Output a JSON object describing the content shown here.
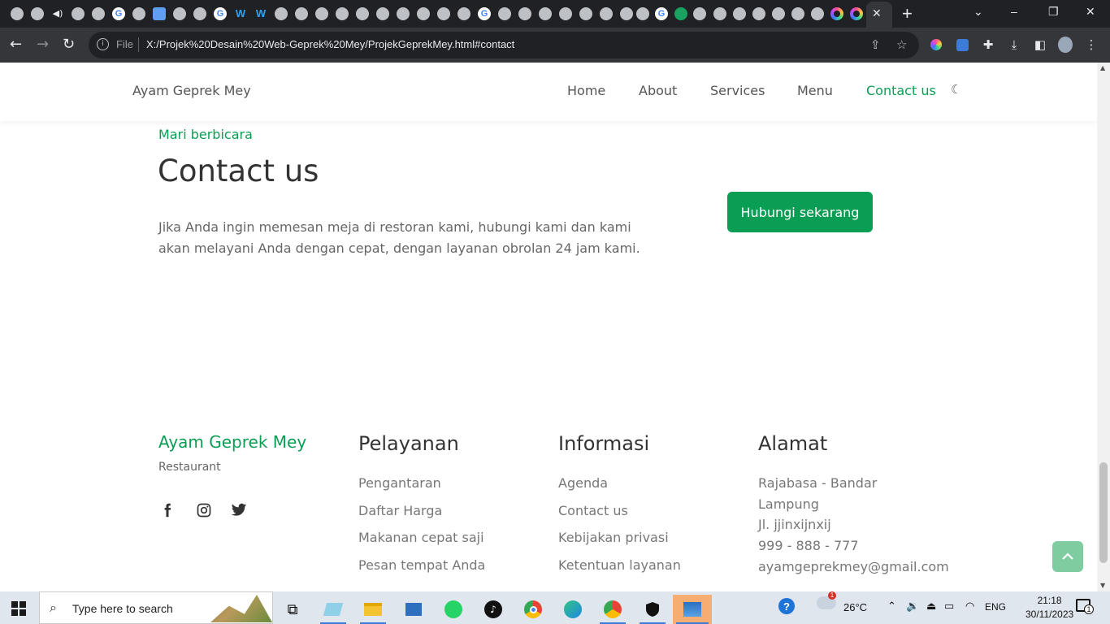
{
  "browser": {
    "tab_close": "✕",
    "new_tab": "+",
    "window_controls": {
      "dropdown": "⌄",
      "minimize": "–",
      "restore": "❐",
      "close": "✕"
    },
    "address": {
      "scheme_label": "File",
      "url": "X:/Projek%20Desain%20Web-Geprek%20Mey/ProjekGeprekMey.html#contact"
    }
  },
  "site": {
    "brand": "Ayam Geprek Mey",
    "nav": {
      "home": "Home",
      "about": "About",
      "services": "Services",
      "menu": "Menu",
      "contact": "Contact us"
    }
  },
  "contact": {
    "eyebrow": "Mari berbicara",
    "title": "Contact us",
    "text": "Jika Anda ingin memesan meja di restoran kami, hubungi kami dan kami akan melayani Anda dengan cepat, dengan layanan obrolan 24 jam kami.",
    "cta": "Hubungi sekarang"
  },
  "footer": {
    "brand": "Ayam Geprek Mey",
    "subtitle": "Restaurant",
    "social_icons": [
      "facebook-icon",
      "instagram-icon",
      "twitter-icon"
    ],
    "pelayanan": {
      "title": "Pelayanan",
      "links": [
        "Pengantaran",
        "Daftar Harga",
        "Makanan cepat saji",
        "Pesan tempat Anda"
      ]
    },
    "informasi": {
      "title": "Informasi",
      "links": [
        "Agenda",
        "Contact us",
        "Kebijakan privasi",
        "Ketentuan layanan"
      ]
    },
    "alamat": {
      "title": "Alamat",
      "line1": "Rajabasa - Bandar",
      "line2": "Lampung",
      "street": "Jl. jjinxijnxij",
      "phone": "999 - 888 - 777",
      "email": "ayamgeprekmey@gmail.com"
    }
  },
  "taskbar": {
    "search_placeholder": "Type here to search",
    "weather": "26°C",
    "language": "ENG",
    "time": "21:18",
    "date": "30/11/2023",
    "notification_count": "1"
  },
  "colors": {
    "accent_green": "#0a9e54",
    "browser_dark": "#202124",
    "taskbar": "#dfe6ee"
  }
}
